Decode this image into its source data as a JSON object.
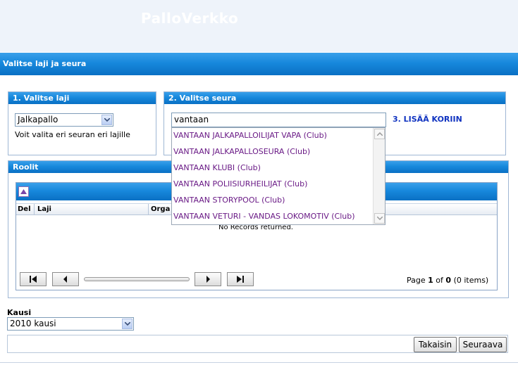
{
  "app": {
    "title": "PalloVerkko"
  },
  "page": {
    "title": "Valitse laji ja seura"
  },
  "sport_panel": {
    "title": "1. Valitse laji",
    "selected": "Jalkapallo",
    "hint": "Voit valita eri seuran eri lajille"
  },
  "club_panel": {
    "title": "2. Valitse seura",
    "input_value": "vantaan",
    "add_link": "3. LISÄÄ KORIIN",
    "suggestions": [
      "VANTAAN JALKAPALLOILIJAT VAPA (Club)",
      "VANTAAN JALKAPALLOSEURA (Club)",
      "VANTAAN KLUBI (Club)",
      "VANTAAN POLIISIURHEILIJAT (Club)",
      "VANTAAN STORYPOOL (Club)",
      "VANTAAN VETURI - VANDAS LOKOMOTIV (Club)"
    ]
  },
  "roles_panel": {
    "title": "Roolit",
    "columns": [
      "Del",
      "Laji",
      "Orga"
    ],
    "empty_text": "No Records returned.",
    "pager": {
      "prefix": "Page",
      "page": "1",
      "of": "of",
      "total": "0",
      "items": "(0 items)"
    }
  },
  "season": {
    "label": "Kausi",
    "selected": "2010 kausi"
  },
  "footer": {
    "back_label": "Takaisin",
    "next_label": "Seuraava"
  },
  "colors": {
    "header_blue": "#1788dc",
    "link_blue": "#1033c0",
    "suggestion_purple": "#6a1b86"
  }
}
